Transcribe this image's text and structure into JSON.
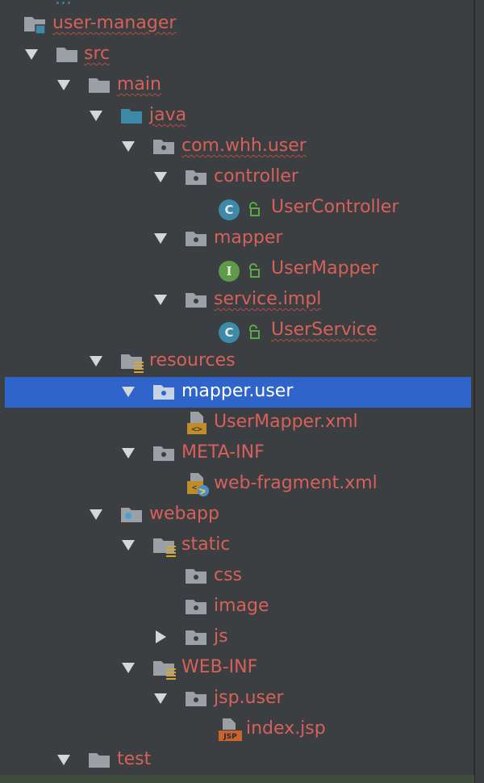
{
  "tree": {
    "top_partial": "...",
    "nodes": {
      "user_manager": "user-manager",
      "src": "src",
      "main": "main",
      "java": "java",
      "com_whh_user": "com.whh.user",
      "controller": "controller",
      "user_controller": "UserController",
      "mapper": "mapper",
      "user_mapper": "UserMapper",
      "service_impl": "service.impl",
      "user_service": "UserService",
      "resources": "resources",
      "mapper_user": "mapper.user",
      "user_mapper_xml": "UserMapper.xml",
      "meta_inf": "META-INF",
      "web_fragment_xml": "web-fragment.xml",
      "webapp": "webapp",
      "static": "static",
      "css": "css",
      "image": "image",
      "js": "js",
      "web_inf": "WEB-INF",
      "jsp_user": "jsp.user",
      "index_jsp": "index.jsp",
      "test": "test"
    },
    "badges": {
      "class": "C",
      "interface": "I"
    },
    "file_tags": {
      "xml": "<>",
      "jsp": "JSP"
    },
    "selected": "mapper.user",
    "colors": {
      "background": "#3c3f41",
      "label": "#d8605a",
      "selection": "#2f65ca",
      "class_badge": "#3d8aa8",
      "interface_badge": "#5e9a47",
      "folder": "#9aa0a6",
      "source_folder": "#3d8aa8"
    }
  }
}
